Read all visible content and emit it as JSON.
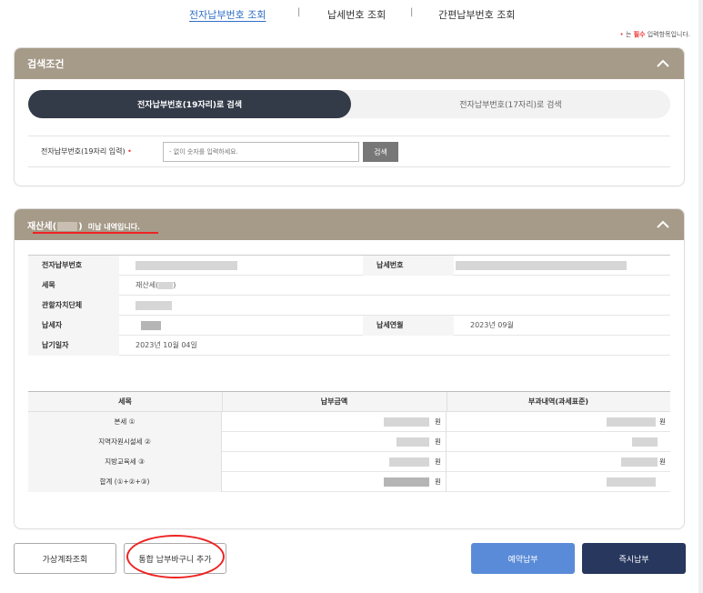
{
  "top_tabs": {
    "tab1": "전자납부번호 조회",
    "sep1": "|",
    "tab2": "납세번호 조회",
    "sep2": "|",
    "tab3": "간편납부번호 조회"
  },
  "required_note": {
    "dot": "•",
    "prefix": " 는 ",
    "emphasis": "필수",
    "suffix": " 입력항목입니다."
  },
  "search": {
    "title": "검색조건",
    "toggle_active": "전자납부번호(19자리)로 검색",
    "toggle_inactive": "전자납부번호(17자리)로 검색",
    "field_label": "전자납부번호(19자리 입력)",
    "required_dot": "•",
    "input_placeholder": "- 없이 숫자를 입력하세요.",
    "search_button": "검색"
  },
  "result": {
    "title_prefix": "재산세(",
    "title_suffix": ")",
    "title_status": "미납 내역입니다.",
    "rows": {
      "elec_no_label": "전자납부번호",
      "tax_no_label": "납세번호",
      "tax_item_label": "세목",
      "tax_item_prefix": "재산세(",
      "tax_item_suffix": ")",
      "authority_label": "관할자치단체",
      "payer_label": "납세자",
      "tax_month_label": "납세연월",
      "tax_month_value": "2023년 09월",
      "due_label": "납기일자",
      "due_value": "2023년 10월 04일"
    },
    "amount_table": {
      "headers": [
        "세목",
        "납부금액",
        "부과내역(과세표준)"
      ],
      "rows": [
        {
          "name": "본세 ①",
          "unit1": "원",
          "unit2": "원"
        },
        {
          "name": "지역자원시설세 ②",
          "unit1": "원",
          "unit2": ""
        },
        {
          "name": "지방교육세 ③",
          "unit1": "원",
          "unit2": "원"
        },
        {
          "name": "합계 (①+②+③)",
          "unit1": "원",
          "unit2": ""
        }
      ]
    }
  },
  "buttons": {
    "virtual_account": "가상계좌조회",
    "add_cart": "통합 납부바구니 추가",
    "reserve_pay": "예약납부",
    "instant_pay": "즉시납부"
  },
  "colors": {
    "header_bg": "#a69a89",
    "toggle_active_bg": "#333a48",
    "link_blue": "#2f6fc7",
    "btn_blue": "#5a8bd8",
    "btn_navy": "#27375e",
    "annotation_red": "#e22222"
  }
}
